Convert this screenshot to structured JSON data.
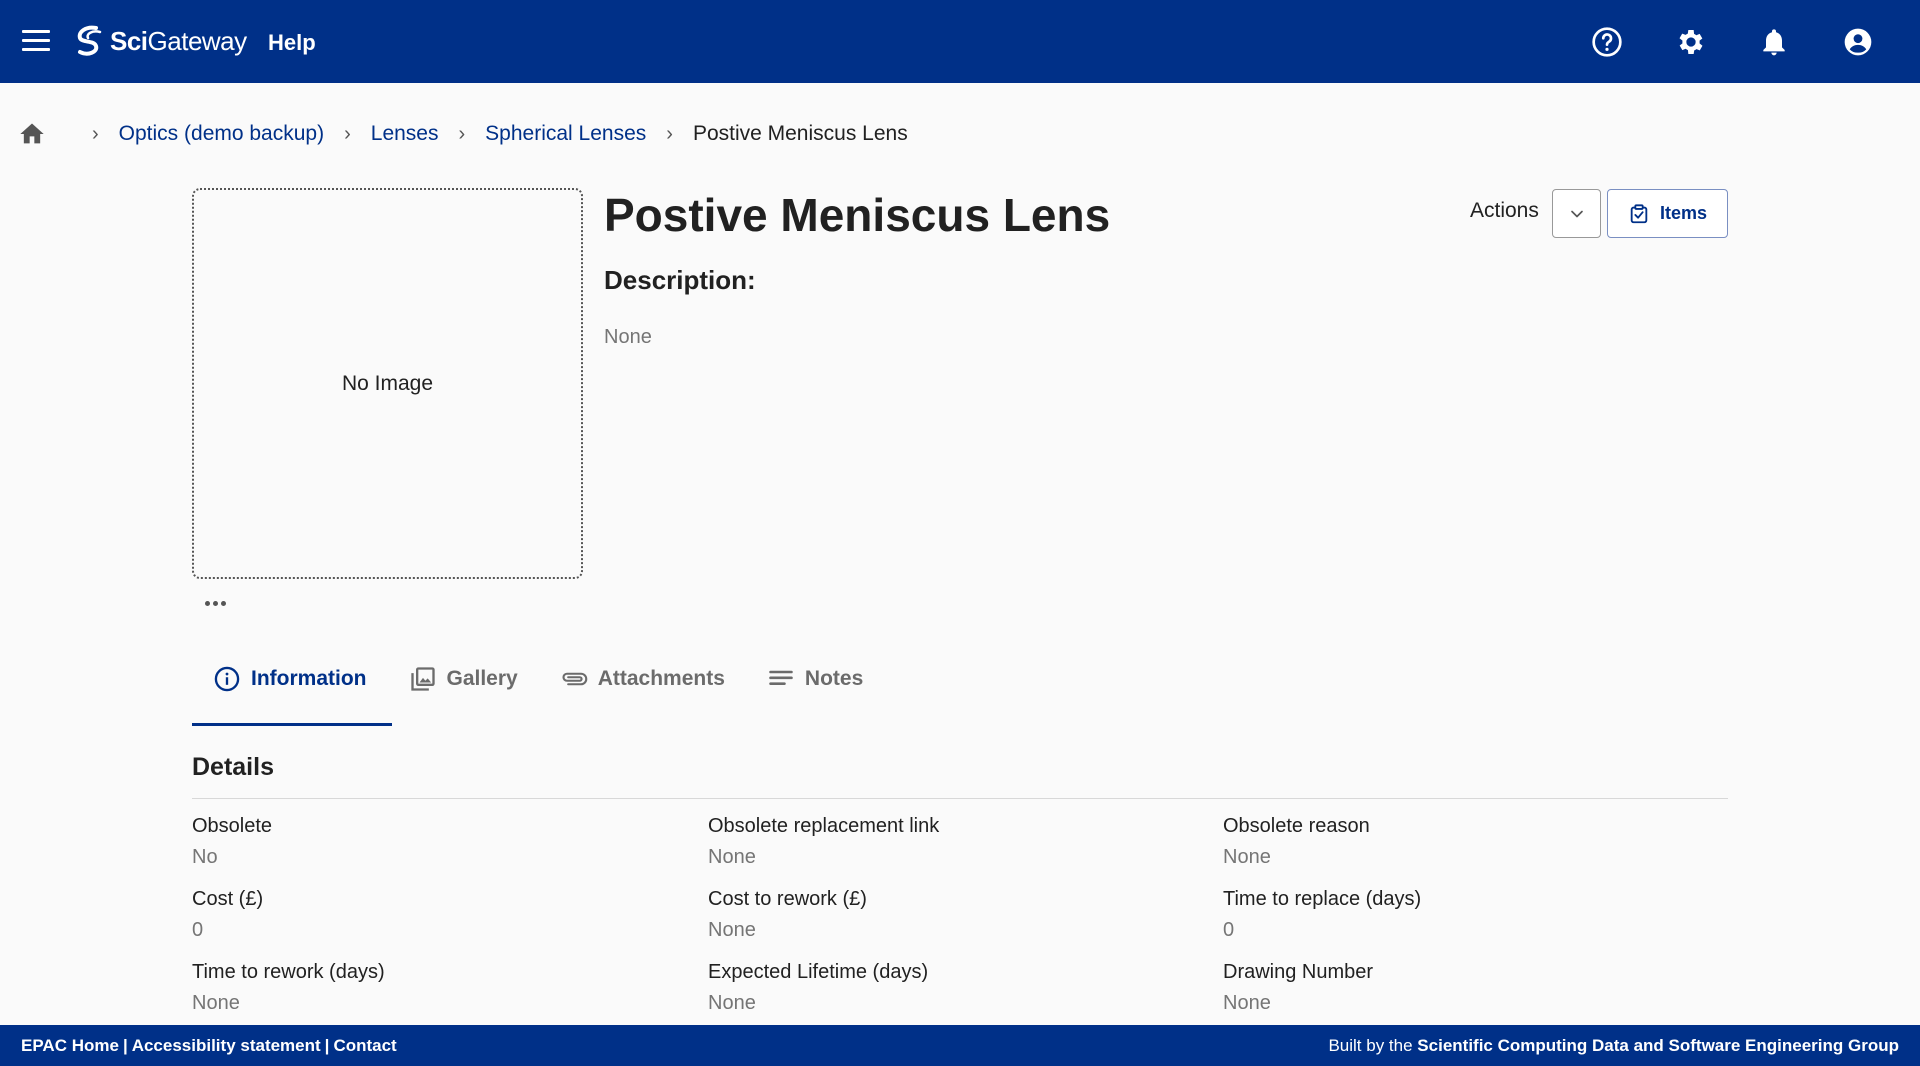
{
  "header": {
    "logo_prefix": "Sci",
    "logo_suffix": "Gateway",
    "help_label": "Help",
    "icons": [
      "menu-icon",
      "help-circle-icon",
      "gear-icon",
      "bell-icon",
      "account-icon"
    ],
    "color": "#003088"
  },
  "breadcrumb": {
    "items": [
      "Optics (demo backup)",
      "Lenses",
      "Spherical Lenses"
    ],
    "current": "Postive Meniscus Lens"
  },
  "catalogue_item": {
    "image_placeholder": "No Image",
    "title": "Postive Meniscus Lens",
    "description_label": "Description:",
    "description_value": "None",
    "actions_label": "Actions",
    "items_button_label": "Items"
  },
  "tabs": [
    {
      "label": "Information",
      "icon": "info-icon",
      "active": true
    },
    {
      "label": "Gallery",
      "icon": "gallery-icon",
      "active": false
    },
    {
      "label": "Attachments",
      "icon": "attachment-icon",
      "active": false
    },
    {
      "label": "Notes",
      "icon": "notes-icon",
      "active": false
    }
  ],
  "details": {
    "title": "Details",
    "fields": [
      {
        "label": "Obsolete",
        "value": "No"
      },
      {
        "label": "Obsolete replacement link",
        "value": "None"
      },
      {
        "label": "Obsolete reason",
        "value": "None"
      },
      {
        "label": "Cost (£)",
        "value": "0"
      },
      {
        "label": "Cost to rework (£)",
        "value": "None"
      },
      {
        "label": "Time to replace (days)",
        "value": "0"
      },
      {
        "label": "Time to rework (days)",
        "value": "None"
      },
      {
        "label": "Expected Lifetime (days)",
        "value": "None"
      },
      {
        "label": "Drawing Number",
        "value": "None"
      }
    ]
  },
  "footer": {
    "links": [
      "EPAC Home",
      "Accessibility statement",
      "Contact"
    ],
    "built_by_prefix": "Built by the",
    "built_by_group": "Scientific Computing Data and Software Engineering Group"
  }
}
